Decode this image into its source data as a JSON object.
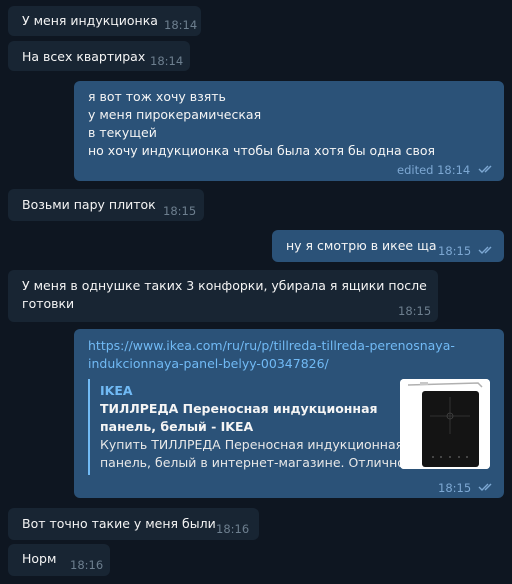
{
  "messages": [
    {
      "text": "У меня индукционка",
      "time": "18:14"
    },
    {
      "text": "На всех квартирах",
      "time": "18:14"
    },
    {
      "lines": [
        "я вот тож хочу взять",
        "у меня пирокерамическая",
        "в текущей",
        "но хочу индукционка чтобы была хотя бы одна своя"
      ],
      "edited_time": "edited 18:14"
    },
    {
      "text": "Возьми пару плиток",
      "time": "18:15"
    },
    {
      "text": "ну я смотрю в икее ща",
      "time": "18:15"
    },
    {
      "lines": [
        "У меня в однушке таких 3 конфорки, убирала я ящики после",
        "готовки"
      ],
      "time": "18:15"
    },
    {
      "link_lines": [
        "https://www.ikea.com/ru/ru/p/tillreda-tillreda-perenosnaya-",
        "indukcionnaya-panel-belyy-00347826/"
      ],
      "preview": {
        "site": "IKEA",
        "title_lines": [
          "ТИЛЛРЕДА Переносная индукционная",
          "панель, белый - IKEA"
        ],
        "desc_lines": [
          "Купить ТИЛЛРЕДА Переносная индукционная",
          "панель, белый в интернет-магазине. Отлично..."
        ]
      },
      "time": "18:15"
    },
    {
      "text": "Вот точно такие у меня были",
      "time": "18:16"
    },
    {
      "text": "Норм",
      "time": "18:16"
    }
  ]
}
